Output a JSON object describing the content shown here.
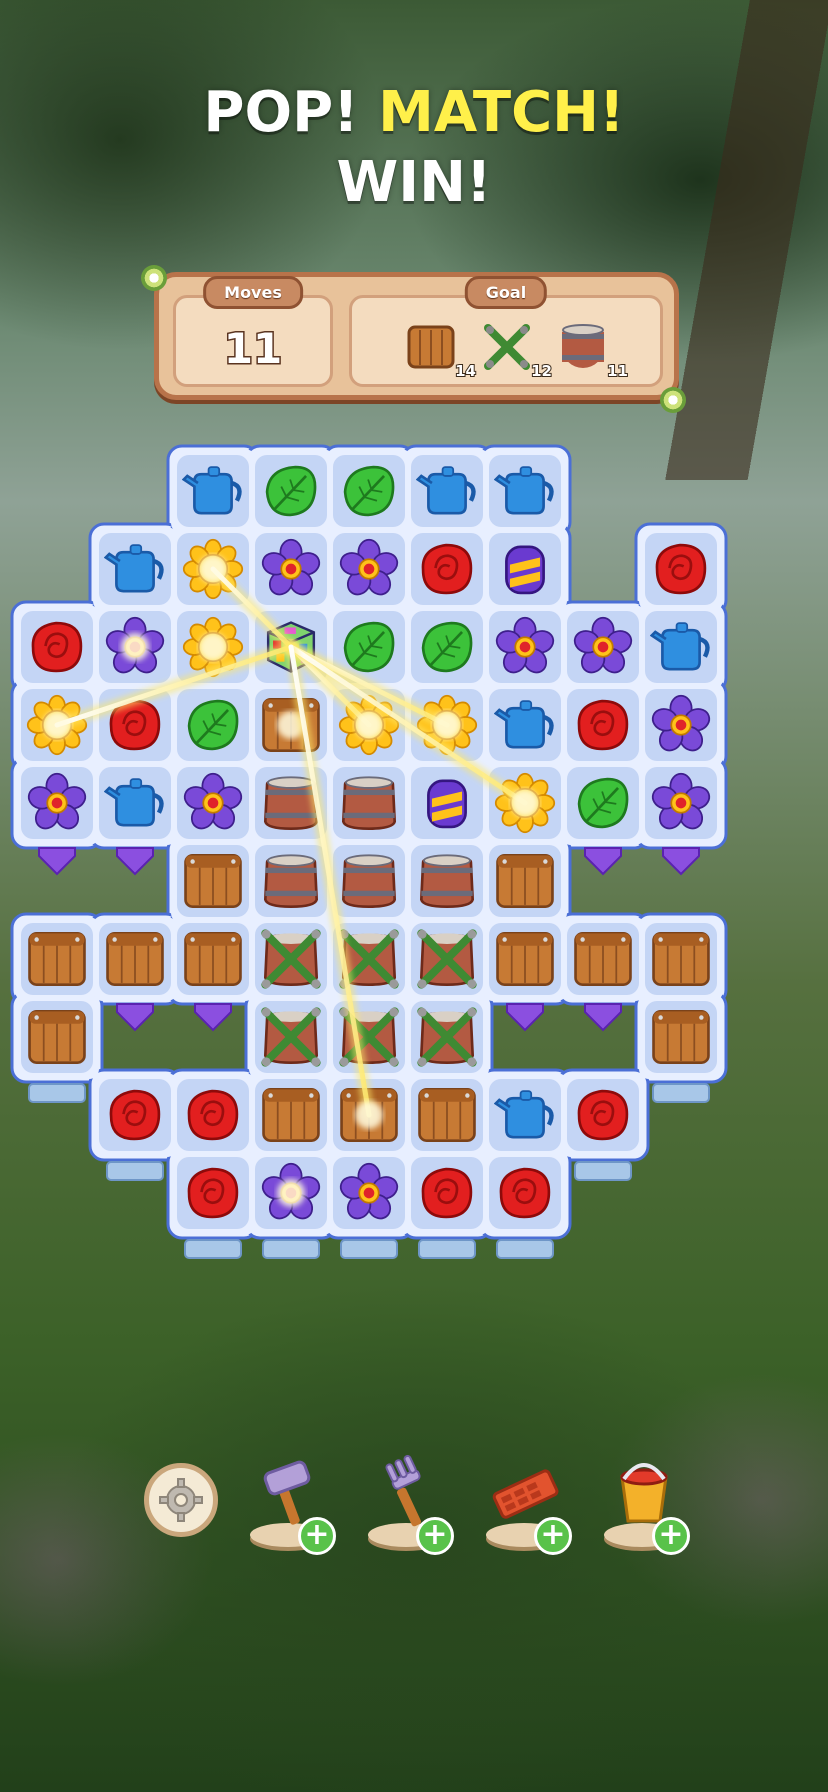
{
  "headline": {
    "part1": "POP!",
    "part2": "MATCH!",
    "part3": "WIN!"
  },
  "hud": {
    "moves_label": "Moves",
    "moves_value": "11",
    "goal_label": "Goal",
    "goals": [
      {
        "icon": "crate-icon",
        "count": "14"
      },
      {
        "icon": "vine-icon",
        "count": "12"
      },
      {
        "icon": "barrel-icon",
        "count": "11"
      }
    ]
  },
  "colors": {
    "accent_yellow": "#fff04a",
    "board_tile": "#c4d5f5",
    "board_frame": "#4b6fd6",
    "plus_green": "#59c24a"
  },
  "board": {
    "rows": [
      [
        null,
        null,
        "can",
        "leaf",
        "leaf",
        "can",
        "can",
        null,
        null
      ],
      [
        null,
        "can",
        "sun",
        "flower",
        "flower",
        "rose",
        "striped",
        null,
        "rose"
      ],
      [
        "rose",
        "flower",
        "sun",
        "cube",
        "leaf",
        "leaf",
        "flower",
        "flower",
        "can"
      ],
      [
        "sun",
        "rose",
        "leaf",
        "crate",
        "sun",
        "sun",
        "can",
        "rose",
        "flower"
      ],
      [
        "flower",
        "can",
        "flower",
        "barrel",
        "barrel",
        "striped",
        "sun",
        "leaf",
        "flower"
      ],
      [
        null,
        null,
        "crate",
        "barrel",
        "barrel",
        "barrel",
        "crate",
        null,
        null
      ],
      [
        "crate",
        "crate",
        "crate",
        "vine",
        "vine",
        "vine",
        "crate",
        "crate",
        "crate"
      ],
      [
        "crate",
        null,
        null,
        "vine",
        "vine",
        "vine",
        null,
        null,
        "crate"
      ],
      [
        null,
        "rose",
        "rose",
        "crate",
        "crate",
        "crate",
        "can",
        "rose",
        null
      ],
      [
        null,
        null,
        "rose",
        "flower",
        "flower",
        "rose",
        "rose",
        null,
        null
      ]
    ]
  },
  "boosters": [
    {
      "name": "hammer",
      "icon": "hammer-icon",
      "plus": "+"
    },
    {
      "name": "fork",
      "icon": "garden-fork-icon",
      "plus": "+"
    },
    {
      "name": "brick",
      "icon": "brick-icon",
      "plus": "+"
    },
    {
      "name": "bucket",
      "icon": "bucket-icon",
      "plus": "+"
    }
  ],
  "settings": {
    "icon": "gear-icon"
  }
}
